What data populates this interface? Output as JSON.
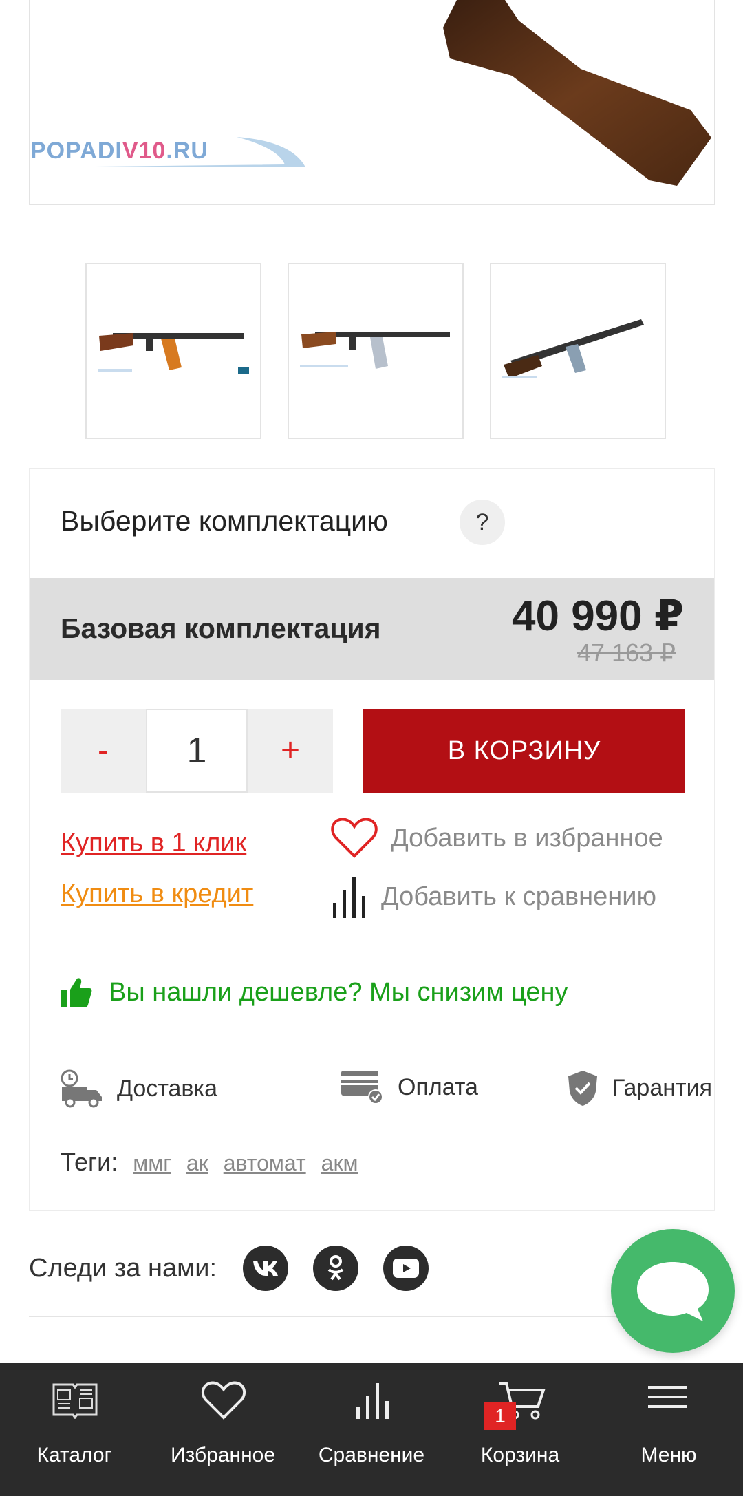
{
  "watermark": {
    "text_main": "POPADI",
    "text_accent": "V10",
    "text_tail": ".RU"
  },
  "thumbnails": [
    "thumb-1",
    "thumb-2",
    "thumb-3"
  ],
  "options": {
    "title": "Выберите комплектацию",
    "help": "?",
    "variant": {
      "name": "Базовая комплектация",
      "price": "40 990 ₽",
      "old_price": "47 163 ₽"
    }
  },
  "quantity": {
    "minus": "-",
    "value": "1",
    "plus": "+"
  },
  "add_to_cart": "В КОРЗИНУ",
  "links": {
    "buy_one_click": "Купить в 1 клик",
    "buy_credit": "Купить в кредит"
  },
  "actions": {
    "favorite": "Добавить в избранное",
    "compare": "Добавить к сравнению"
  },
  "cheaper": "Вы нашли дешевле? Мы снизим цену",
  "info": {
    "delivery": "Доставка",
    "payment": "Оплата",
    "warranty": "Гарантия"
  },
  "tags": {
    "label": "Теги:",
    "items": [
      "ммг",
      "ак",
      "автомат",
      "акм"
    ]
  },
  "follow": {
    "label": "Следи за нами:"
  },
  "nav": {
    "catalog": "Каталог",
    "favorites": "Избранное",
    "compare": "Сравнение",
    "cart": "Корзина",
    "cart_count": "1",
    "menu": "Меню"
  },
  "colors": {
    "accent_red": "#b30f14",
    "link_red": "#e02424",
    "link_orange": "#f08c12",
    "green": "#1aa01a",
    "chat_green": "#45b96b"
  }
}
